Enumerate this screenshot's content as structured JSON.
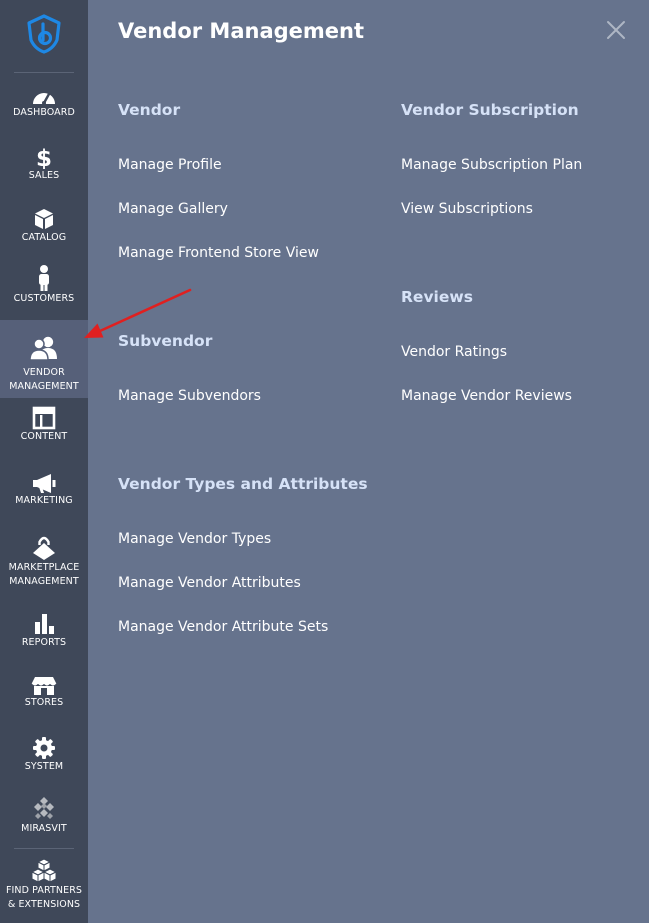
{
  "sidebar": {
    "logo_icon": "shield-logo-icon",
    "items": [
      {
        "label": "DASHBOARD",
        "icon": "speedometer-icon"
      },
      {
        "label": "SALES",
        "icon": "dollar-icon"
      },
      {
        "label": "CATALOG",
        "icon": "box-icon"
      },
      {
        "label": "CUSTOMERS",
        "icon": "person-icon"
      },
      {
        "label": "VENDOR",
        "label2": "MANAGEMENT",
        "icon": "users-icon",
        "active": true
      },
      {
        "label": "CONTENT",
        "icon": "layout-icon"
      },
      {
        "label": "MARKETING",
        "icon": "megaphone-icon"
      },
      {
        "label": "MARKETPLACE",
        "label2": "MANAGEMENT",
        "icon": "shopping-bag-icon"
      },
      {
        "label": "REPORTS",
        "icon": "bar-chart-icon"
      },
      {
        "label": "STORES",
        "icon": "storefront-icon"
      },
      {
        "label": "SYSTEM",
        "icon": "gear-icon"
      },
      {
        "label": "MIRASVIT",
        "icon": "diamond-grid-icon"
      },
      {
        "label": "FIND PARTNERS",
        "label2": "& EXTENSIONS",
        "icon": "cubes-icon"
      }
    ]
  },
  "panel": {
    "title": "Vendor Management",
    "close_icon": "close-icon",
    "sections": [
      {
        "heading": "Vendor",
        "links": [
          "Manage Profile",
          "Manage Gallery",
          "Manage Frontend Store View"
        ]
      },
      {
        "heading": "Subvendor",
        "links": [
          "Manage Subvendors"
        ]
      },
      {
        "heading": "Vendor Types and Attributes",
        "links": [
          "Manage Vendor Types",
          "Manage Vendor Attributes",
          "Manage Vendor Attribute Sets"
        ]
      },
      {
        "heading": "Vendor Subscription",
        "links": [
          "Manage Subscription Plan",
          "View Subscriptions"
        ]
      },
      {
        "heading": "Reviews",
        "links": [
          "Vendor Ratings",
          "Manage Vendor Reviews"
        ]
      }
    ]
  },
  "colors": {
    "sidebar_bg": "#3f4859",
    "sidebar_active": "#566079",
    "panel_bg": "#66738d",
    "section_heading": "#d6e2f7",
    "annotation_arrow": "#e02020"
  }
}
